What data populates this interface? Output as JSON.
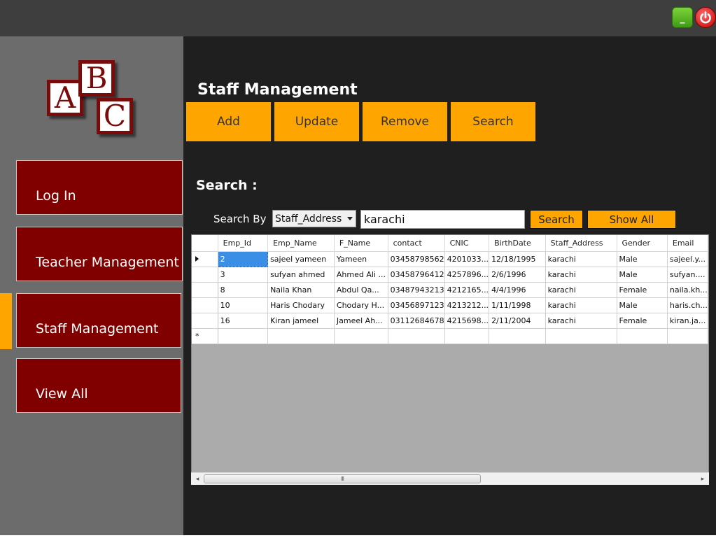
{
  "window": {
    "minimize_label": "_",
    "minimize_icon": "minimize-icon",
    "power_icon": "power-icon"
  },
  "logo": {
    "letters": [
      "A",
      "B",
      "C"
    ]
  },
  "sidebar": {
    "items": [
      {
        "label": "Log In"
      },
      {
        "label": "Teacher Management"
      },
      {
        "label": "Staff Management",
        "active": true
      },
      {
        "label": "View All"
      }
    ]
  },
  "page": {
    "title": "Staff Management"
  },
  "toolbar": {
    "add_label": "Add",
    "update_label": "Update",
    "remove_label": "Remove",
    "search_label": "Search"
  },
  "search": {
    "heading": "Search :",
    "by_label": "Search By",
    "by_value": "Staff_Address",
    "query": "karachi",
    "search_button": "Search",
    "show_all_button": "Show All"
  },
  "grid": {
    "columns": [
      "Emp_Id",
      "Emp_Name",
      "F_Name",
      "contact",
      "CNIC",
      "BirthDate",
      "Staff_Address",
      "Gender",
      "Email"
    ],
    "rows": [
      [
        "2",
        "sajeel yameen",
        "Yameen",
        "03458798562",
        "4201033...",
        "12/18/1995",
        "karachi",
        "Male",
        "sajeel.y..."
      ],
      [
        "3",
        "sufyan ahmed",
        "Ahmed Ali ...",
        "03458796412",
        "4257896...",
        "2/6/1996",
        "karachi",
        "Male",
        "sufyan...."
      ],
      [
        "8",
        "Naila Khan",
        "Abdul Qa...",
        "03487943213",
        "4212165...",
        "4/4/1996",
        "karachi",
        "Female",
        "naila.kh..."
      ],
      [
        "10",
        "Haris Chodary",
        "Chodary H...",
        "03456897123",
        "4213212...",
        "1/11/1998",
        "karachi",
        "Male",
        "haris.ch..."
      ],
      [
        "16",
        "Kiran jameel",
        "Jameel Ah...",
        "03112684678",
        "4215698...",
        "2/11/2004",
        "karachi",
        "Female",
        "kiran.ja..."
      ]
    ],
    "new_row_marker": "*"
  },
  "scrollbar": {
    "left_arrow": "◂",
    "right_arrow": "▸",
    "grip": "III"
  },
  "colors": {
    "accent": "#ffa500",
    "nav_button": "#800000",
    "sidebar": "#6c6c6c",
    "main_bg": "#1f1f1f",
    "topbar": "#3e3e3e"
  }
}
